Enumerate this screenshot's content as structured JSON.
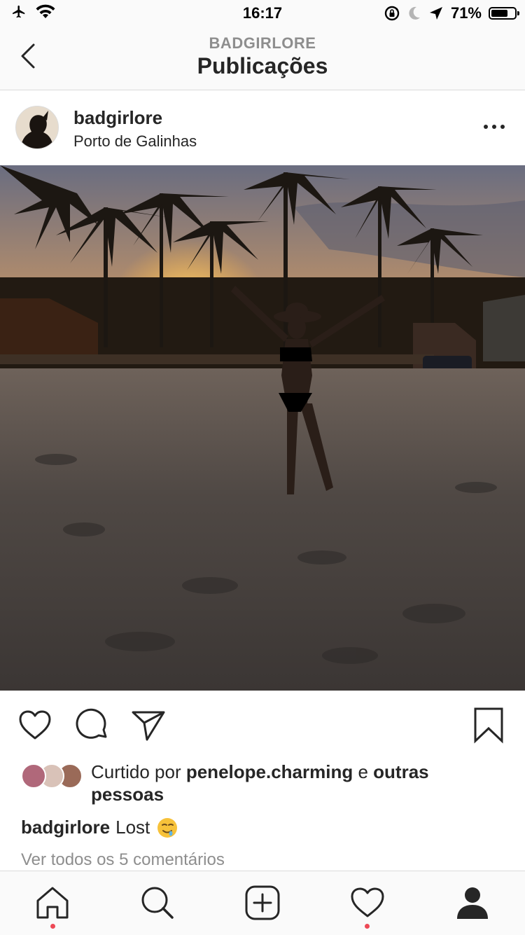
{
  "status_bar": {
    "time": "16:17",
    "battery_percent": "71%",
    "battery_level": 0.71,
    "icons": [
      "airplane-icon",
      "wifi-icon",
      "rotation-lock-icon",
      "moon-icon",
      "location-arrow-icon",
      "battery-icon"
    ]
  },
  "header": {
    "subtitle": "BADGIRLORE",
    "title": "Publicações"
  },
  "post": {
    "username": "badgirlore",
    "location": "Porto de Galinhas",
    "likes": {
      "prefix": "Curtido por ",
      "user": "penelope.charming",
      "connector": " e ",
      "others": "outras pessoas"
    },
    "caption": {
      "username": "badgirlore",
      "text": "Lost"
    },
    "view_comments": "Ver todos os 5 comentários"
  },
  "tab_bar": {
    "items": [
      "home-icon",
      "search-icon",
      "new-post-icon",
      "activity-heart-icon",
      "profile-icon"
    ],
    "notification_color": "#ed4956"
  },
  "colors": {
    "text": "#262626",
    "secondary_text": "#8e8e8e",
    "divider": "#dbdbdb",
    "bar_background": "#fafafa"
  }
}
